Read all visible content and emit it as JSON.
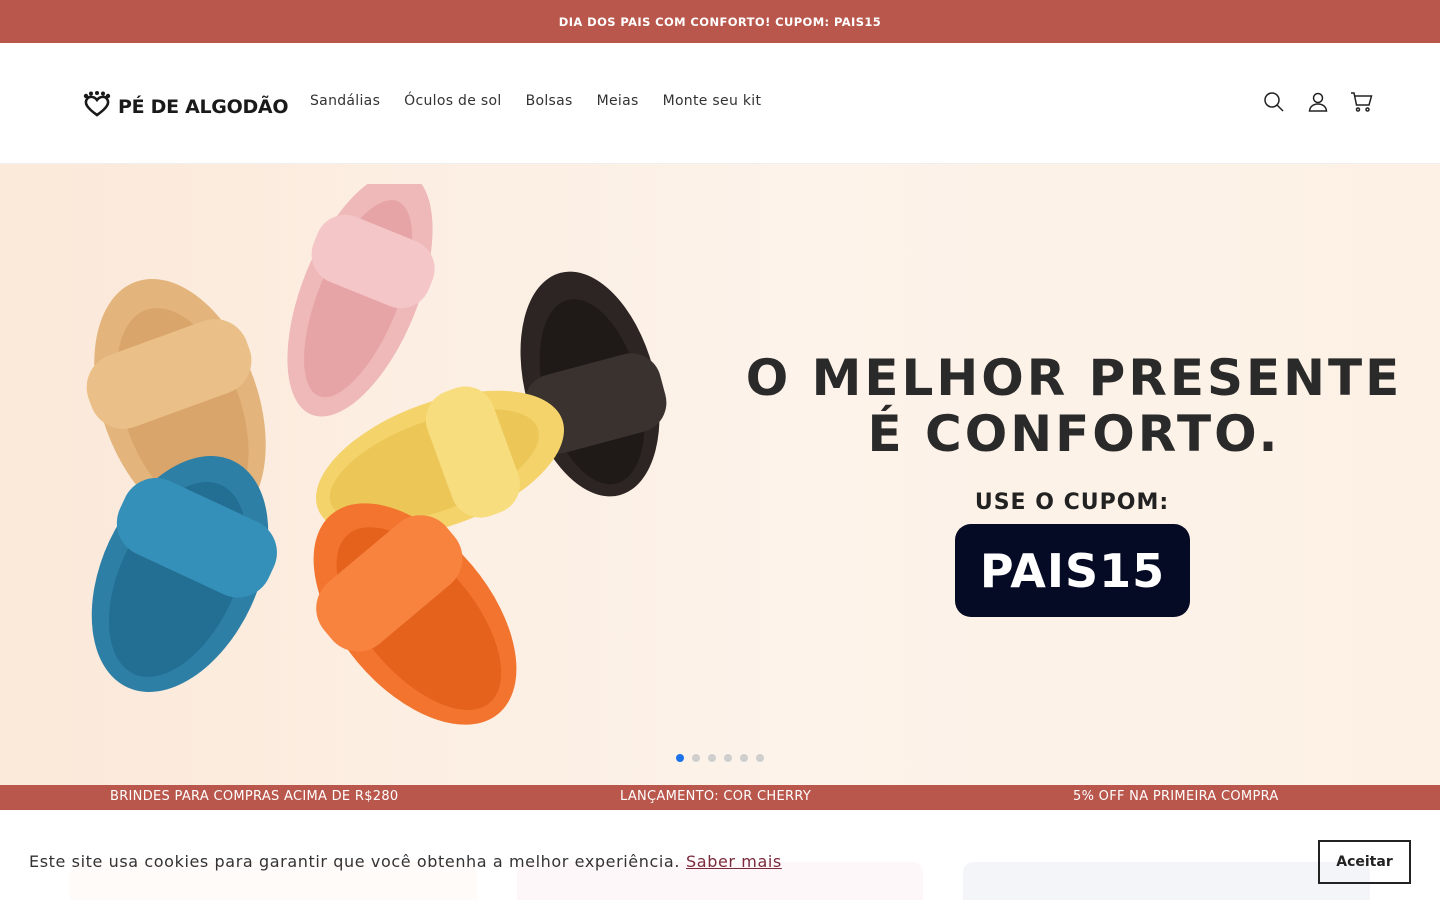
{
  "announcement": "DIA DOS PAIS COM CONFORTO! CUPOM: PAIS15",
  "brand": {
    "name": "PÉ DE ALGODÃO"
  },
  "nav": {
    "items": [
      "Sandálias",
      "Óculos de sol",
      "Bolsas",
      "Meias",
      "Monte seu kit"
    ]
  },
  "header_icons": [
    "search-icon",
    "account-icon",
    "cart-icon"
  ],
  "hero": {
    "title_line1": "O MELHOR PRESENTE",
    "title_line2": "É CONFORTO.",
    "subtitle": "USE O CUPOM:",
    "coupon": "PAIS15",
    "slide_count": 6,
    "active_slide": 1
  },
  "benefits_strip": {
    "items": [
      "BRINDES PARA COMPRAS ACIMA DE R$280",
      "LANÇAMENTO: COR CHERRY",
      "5% OFF NA PRIMEIRA COMPRA"
    ]
  },
  "cookie_banner": {
    "text": "Este site usa cookies para garantir que você obtenha a melhor experiência.",
    "link": "Saber mais",
    "button": "Aceitar"
  },
  "colors": {
    "accent": "#b9574c",
    "coupon_bg": "#060b25",
    "hero_bg": "#fdf1e5"
  }
}
